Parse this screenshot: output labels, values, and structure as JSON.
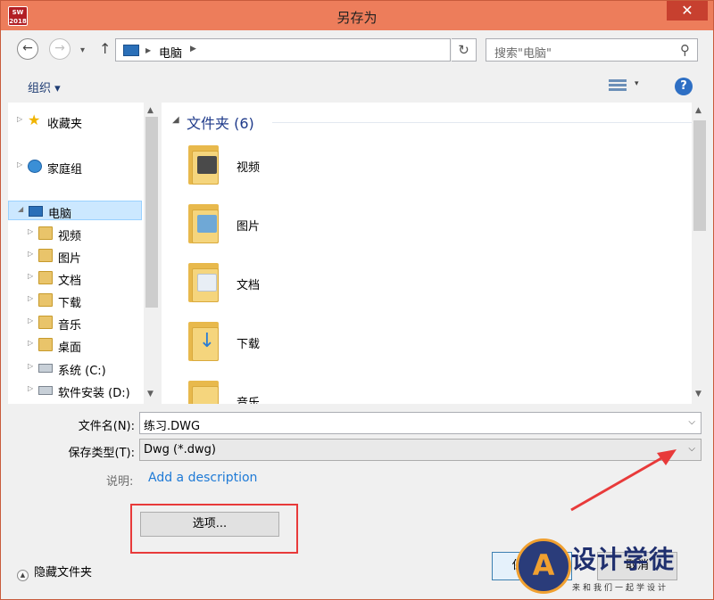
{
  "window": {
    "title": "另存为",
    "app_icon_text": "SW 2018",
    "close_glyph": "✕"
  },
  "nav_bar": {
    "back_glyph": "←",
    "forward_glyph": "→",
    "recent_glyph": "▾",
    "up_glyph": "↑",
    "address": "电脑",
    "address_sep_glyph": "▶",
    "address_dropdown_glyph": "▾",
    "refresh_glyph": "↻",
    "search_placeholder": "搜索\"电脑\"",
    "search_glyph": "⚲"
  },
  "toolbar": {
    "organize": "组织 ▾",
    "view_dropdown_glyph": "▾",
    "help_glyph": "?"
  },
  "sidebar": {
    "items": [
      {
        "label": "收藏夹",
        "icon": "star-icon"
      },
      {
        "label": "家庭组",
        "icon": "homegroup-icon"
      },
      {
        "label": "电脑",
        "icon": "computer-icon",
        "selected": true
      },
      {
        "label": "视频",
        "icon": "videos-folder-icon"
      },
      {
        "label": "图片",
        "icon": "pictures-folder-icon"
      },
      {
        "label": "文档",
        "icon": "documents-folder-icon"
      },
      {
        "label": "下载",
        "icon": "downloads-folder-icon"
      },
      {
        "label": "音乐",
        "icon": "music-folder-icon"
      },
      {
        "label": "桌面",
        "icon": "desktop-folder-icon"
      },
      {
        "label": "系统 (C:)",
        "icon": "drive-c-icon"
      },
      {
        "label": "软件安装 (D:)",
        "icon": "drive-d-icon"
      }
    ]
  },
  "content": {
    "group_title": "文件夹 (6)",
    "folders": [
      {
        "label": "视频",
        "icon": "videos-folder-icon"
      },
      {
        "label": "图片",
        "icon": "pictures-folder-icon"
      },
      {
        "label": "文档",
        "icon": "documents-folder-icon"
      },
      {
        "label": "下载",
        "icon": "downloads-folder-icon"
      },
      {
        "label": "音乐",
        "icon": "music-folder-icon"
      }
    ]
  },
  "form": {
    "filename_label": "文件名(N):",
    "filename_value": "练习.DWG",
    "filetype_label": "保存类型(T):",
    "filetype_value": "Dwg (*.dwg)",
    "description_label": "说明:",
    "description_link": "Add a description",
    "options_button": "选项...",
    "hide_folders": "隐藏文件夹",
    "save_button": "保存(S)",
    "cancel_button": "取消"
  },
  "watermark": {
    "title": "设计学徒",
    "subtitle": "来和我们一起学设计",
    "logo_letter": "A"
  },
  "colors": {
    "titlebar": "#ed7d5b",
    "close": "#c7402f",
    "selection": "#cce8ff",
    "link": "#1e7ad6",
    "annotation_red": "#e83a3a"
  }
}
